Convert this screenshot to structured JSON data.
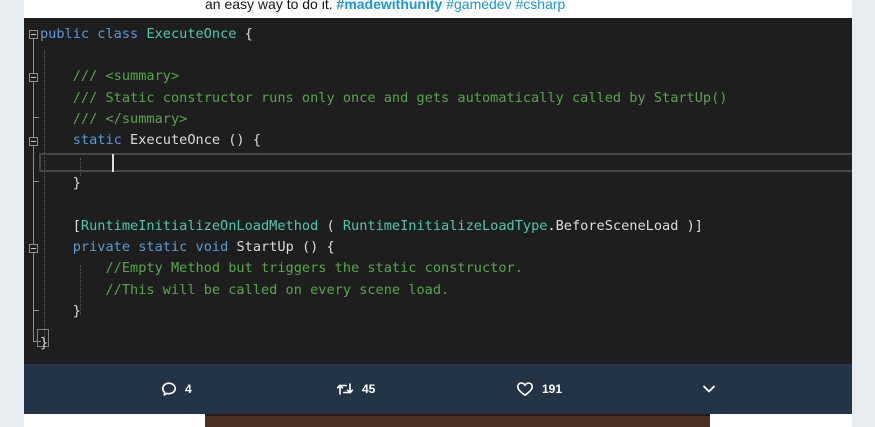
{
  "tweet": {
    "text_prefix": "an easy way to do it. ",
    "hashtags": [
      "#madewithunity",
      "#gamedev",
      "#csharp"
    ]
  },
  "code": {
    "lines": [
      [
        {
          "t": "public",
          "c": "kw"
        },
        {
          "t": " "
        },
        {
          "t": "class",
          "c": "kw"
        },
        {
          "t": " "
        },
        {
          "t": "ExecuteOnce",
          "c": "type"
        },
        {
          "t": " {"
        }
      ],
      [],
      [
        {
          "t": "    "
        },
        {
          "t": "/// <summary>",
          "c": "cm"
        }
      ],
      [
        {
          "t": "    "
        },
        {
          "t": "/// Static constructor runs only once and gets automatically called by StartUp()",
          "c": "cm"
        }
      ],
      [
        {
          "t": "    "
        },
        {
          "t": "/// </summary>",
          "c": "cm"
        }
      ],
      [
        {
          "t": "    "
        },
        {
          "t": "static",
          "c": "kw"
        },
        {
          "t": " ExecuteOnce () {"
        }
      ],
      [],
      [
        {
          "t": "    }"
        }
      ],
      [],
      [
        {
          "t": "    ["
        },
        {
          "t": "RuntimeInitializeOnLoadMethod",
          "c": "type"
        },
        {
          "t": " ( "
        },
        {
          "t": "RuntimeInitializeLoadType",
          "c": "type"
        },
        {
          "t": ".BeforeSceneLoad )]"
        }
      ],
      [
        {
          "t": "    "
        },
        {
          "t": "private",
          "c": "kw"
        },
        {
          "t": " "
        },
        {
          "t": "static",
          "c": "kw"
        },
        {
          "t": " "
        },
        {
          "t": "void",
          "c": "kw"
        },
        {
          "t": " StartUp () {"
        }
      ],
      [
        {
          "t": "        "
        },
        {
          "t": "//Empty Method but triggers the static constructor.",
          "c": "cm"
        }
      ],
      [
        {
          "t": "        "
        },
        {
          "t": "//This will be called on every scene load.",
          "c": "cm"
        }
      ],
      [
        {
          "t": "    }"
        }
      ],
      [],
      [
        {
          "t": "}"
        }
      ]
    ]
  },
  "actions": {
    "reply": {
      "icon": "reply-icon",
      "count": "4"
    },
    "retweet": {
      "icon": "retweet-icon",
      "count": "45"
    },
    "like": {
      "icon": "heart-icon",
      "count": "191"
    },
    "more": {
      "icon": "chevron-down-icon"
    }
  },
  "colors": {
    "editor_bg": "#1e1e1e",
    "keyword": "#569cd6",
    "type": "#4ec9b0",
    "comment": "#57a64a",
    "plain": "#dcdcdc",
    "action_bar": "#243447",
    "hashtag": "#1b95e0"
  }
}
